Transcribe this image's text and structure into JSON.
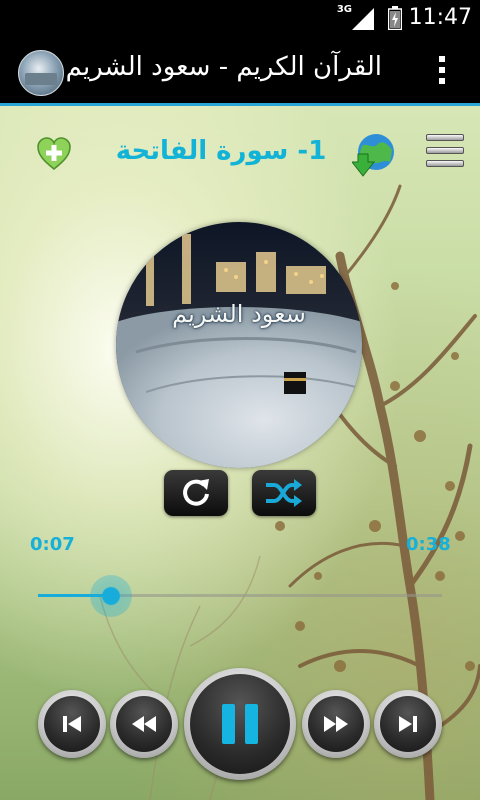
{
  "status_bar": {
    "network": "3G",
    "time": "11:47"
  },
  "action_bar": {
    "title": "القرآن الكريم - سعود الشريم",
    "app_icon": "kaaba-thumbnail",
    "menu_icon": "overflow-menu-icon"
  },
  "player": {
    "track_title": "1- سورة الفاتحة",
    "cover_caption": "سعود الشريم",
    "time_elapsed": "0:07",
    "time_total": "0:38",
    "progress": 0.18,
    "icons": {
      "favorite": "heart-plus-icon",
      "download": "globe-download-icon",
      "playlist": "list-icon",
      "repeat": "repeat-icon",
      "shuffle": "shuffle-icon",
      "previous": "skip-previous-icon",
      "rewind": "rewind-icon",
      "pause": "pause-icon",
      "fast_forward": "fast-forward-icon",
      "next": "skip-next-icon"
    }
  },
  "colors": {
    "accent": "#16b0d8",
    "title_text": "#12b3d6"
  }
}
